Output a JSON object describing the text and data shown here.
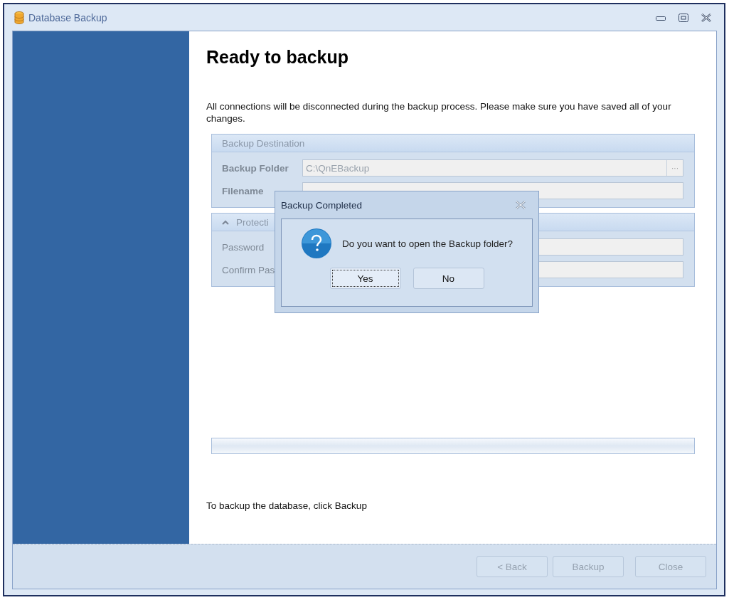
{
  "window": {
    "title": "Database Backup"
  },
  "heading": "Ready to backup",
  "notice": "All connections will be disconnected during the backup process. Please make sure you have saved all of your changes.",
  "destination_group": {
    "title": "Backup Destination",
    "disabled": true,
    "fields": [
      {
        "label": "Backup Folder",
        "value": "C:\\QnEBackup",
        "browse": "···"
      },
      {
        "label": "Filename"
      }
    ]
  },
  "protection_group": {
    "title": "Protecti",
    "expanded": true,
    "disabled": true,
    "fields": [
      {
        "label": "Password"
      },
      {
        "label": "Confirm Pas"
      }
    ]
  },
  "progress": {
    "level": 0
  },
  "hint": "To backup the database, click Backup",
  "buttons": [
    {
      "label": "< Back",
      "disabled": true
    },
    {
      "label": "Backup",
      "disabled": true
    },
    {
      "label": "Close",
      "disabled": true
    }
  ],
  "dialog": {
    "title": "Backup Completed",
    "message": "Do you want to open the Backup folder?",
    "buttons": [
      {
        "label": "Yes",
        "focused": true
      },
      {
        "label": "No",
        "focused": false
      }
    ]
  }
}
